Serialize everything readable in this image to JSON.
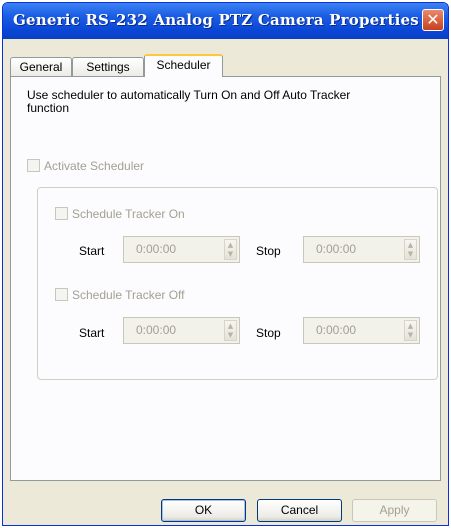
{
  "window": {
    "title": "Generic RS-232 Analog PTZ Camera Properties",
    "close_glyph": "✕"
  },
  "tabs": [
    {
      "label": "General",
      "active": false
    },
    {
      "label": "Settings",
      "active": false
    },
    {
      "label": "Scheduler",
      "active": true
    }
  ],
  "scheduler": {
    "description": "Use scheduler to automatically Turn On and Off Auto Tracker function",
    "activate_label": "Activate Scheduler",
    "tracker_on": {
      "label": "Schedule Tracker On",
      "start_label": "Start",
      "start_value": "0:00:00",
      "stop_label": "Stop",
      "stop_value": "0:00:00"
    },
    "tracker_off": {
      "label": "Schedule Tracker Off",
      "start_label": "Start",
      "start_value": "0:00:00",
      "stop_label": "Stop",
      "stop_value": "0:00:00"
    }
  },
  "buttons": {
    "ok": "OK",
    "cancel": "Cancel",
    "apply": "Apply"
  },
  "icons": {
    "spin_up": "▲",
    "spin_down": "▼"
  }
}
